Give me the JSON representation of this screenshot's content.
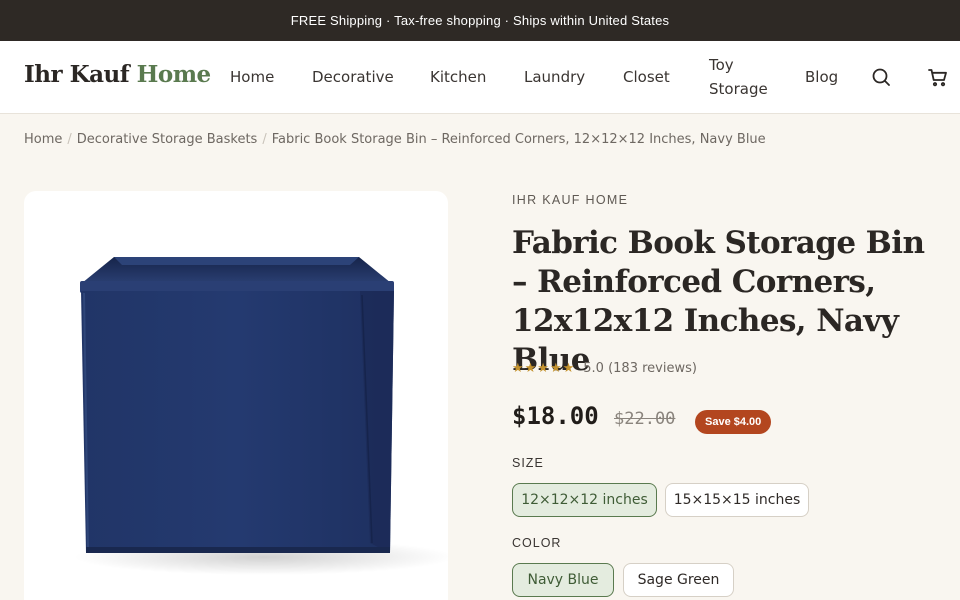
{
  "announcement": "FREE Shipping · Tax-free shopping · Ships within United States",
  "header": {
    "logo_part1": "Ihr Kauf",
    "logo_part2": "Home",
    "nav": [
      "Home",
      "Decorative",
      "Kitchen",
      "Laundry",
      "Closet",
      "Toy Storage",
      "Blog"
    ],
    "icons": [
      "search-icon",
      "cart-icon"
    ]
  },
  "breadcrumb": [
    "Home",
    "Decorative Storage Baskets",
    "Fabric Book Storage Bin – Reinforced Corners, 12×12×12 Inches, Navy Blue"
  ],
  "product": {
    "brand": "IHR KAUF HOME",
    "title": "Fabric Book Storage Bin – Reinforced Corners, 12x12x12 Inches, Navy Blue",
    "stars": "★★★★★",
    "rating_text": "5.0 (183 reviews)",
    "price": "$18.00",
    "compare_price": "$22.00",
    "save_badge": "Save $4.00",
    "size_label": "SIZE",
    "sizes": [
      "12×12×12 inches",
      "15×15×15 inches"
    ],
    "selected_size": "12×12×12 inches",
    "color_label": "COLOR",
    "colors": [
      "Navy Blue",
      "Sage Green"
    ],
    "selected_color": "Navy Blue"
  },
  "colors": {
    "announcement_bg": "#2e2925",
    "brand_green": "#5a7a4f",
    "badge_red": "#b3461f",
    "star_gold": "#c4932f",
    "bin_navy": "#1f3366",
    "page_bg": "#f9f6f0"
  }
}
